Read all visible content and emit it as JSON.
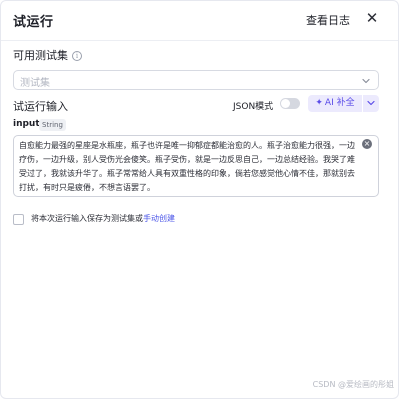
{
  "header": {
    "title": "试运行",
    "view_logs": "查看日志",
    "close": "✕"
  },
  "test_set": {
    "label": "可用测试集",
    "placeholder": "测试集"
  },
  "trial_input": {
    "label": "试运行输入",
    "json_mode_label": "JSON模式",
    "json_mode_enabled": false,
    "ai_button_label": "AI 补全"
  },
  "input_field": {
    "name": "input",
    "type": "String",
    "value": "自愈能力最强的星座是水瓶座，瓶子也许是唯一抑郁症都能治愈的人。瓶子治愈能力很强，一边疗伤，一边升级，别人受伤光会傻笑。瓶子受伤，就是一边反思自己，一边总结经验。我哭了难受过了，我就该升华了。瓶子常常给人具有双重性格的印象，倘若您感觉他心情不佳，那就别去打扰，有时只是疲倦，不想言语罢了。"
  },
  "save_option": {
    "label": "将本次运行输入保存为测试集或",
    "link": "手动创建",
    "checked": false
  },
  "watermark": "CSDN @爱绘画的彤姐",
  "colors": {
    "accent": "#5b4de8",
    "accent_bg": "#eceafd",
    "link": "#4d57e8"
  }
}
